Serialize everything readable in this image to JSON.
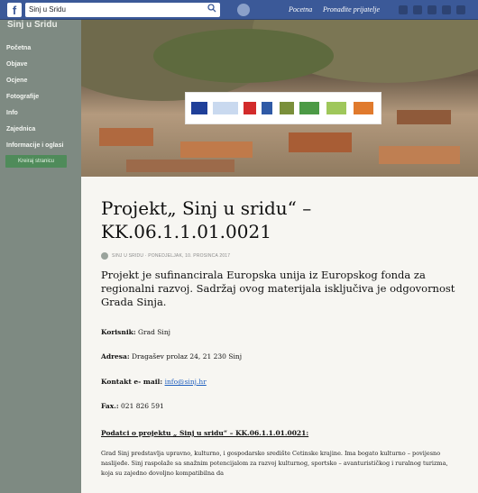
{
  "browser_bar": {
    "logo": "f",
    "search_value": "Sinj u Sridu",
    "nav": [
      "Pocetna",
      "Pronađite prijatelje"
    ]
  },
  "sidebar": {
    "title": "Sinj u Sridu",
    "items": [
      {
        "label": "Početna"
      },
      {
        "label": "Objave"
      },
      {
        "label": "Ocjene"
      },
      {
        "label": "Fotografije"
      },
      {
        "label": "Info"
      },
      {
        "label": "Zajednica"
      },
      {
        "label": "Informacije i oglasi"
      }
    ],
    "button_label": "Kreiraj stranicu"
  },
  "article": {
    "title": "Projekt„ Sinj u sridu“ – KK.06.1.1.01.0021",
    "meta": "SINJ U SRIDU · PONEDJELJAK, 10. PROSINCA 2017",
    "lead": "Projekt je sufinancirala Europska unija iz Europskog fonda za regionalni razvoj. Sadržaj ovog materijala isključiva je odgovornost Grada Sinja.",
    "rows": [
      {
        "label": "Korisnik:",
        "value": "Grad Sinj"
      },
      {
        "label": "Adresa:",
        "value": "Dragašev prolaz 24, 21 230 Sinj"
      },
      {
        "label": "Kontakt e- mail:",
        "value": "info@sinj.hr"
      },
      {
        "label": "Fax.:",
        "value": "021 826 591"
      }
    ],
    "section_heading": "Podatci o projektu „ Sinj u sridu“ – KK.06.1.1.01.0021:",
    "body": "Grad Sinj predstavlja upravno, kulturno, i gospodarsko središte Cetinske krajine. Ima bogato kulturno – povijesno naslijeđe. Sinj raspolaže sa snažnim potencijalom za razvoj kulturnog, sportsko – avanturističkog i ruralnog turizma, koja su zajedno dovoljno kompatibilna da"
  },
  "colors": {
    "facebook_blue": "#3b5998",
    "sidebar": "#7e8a82",
    "link": "#1f5fbf"
  }
}
